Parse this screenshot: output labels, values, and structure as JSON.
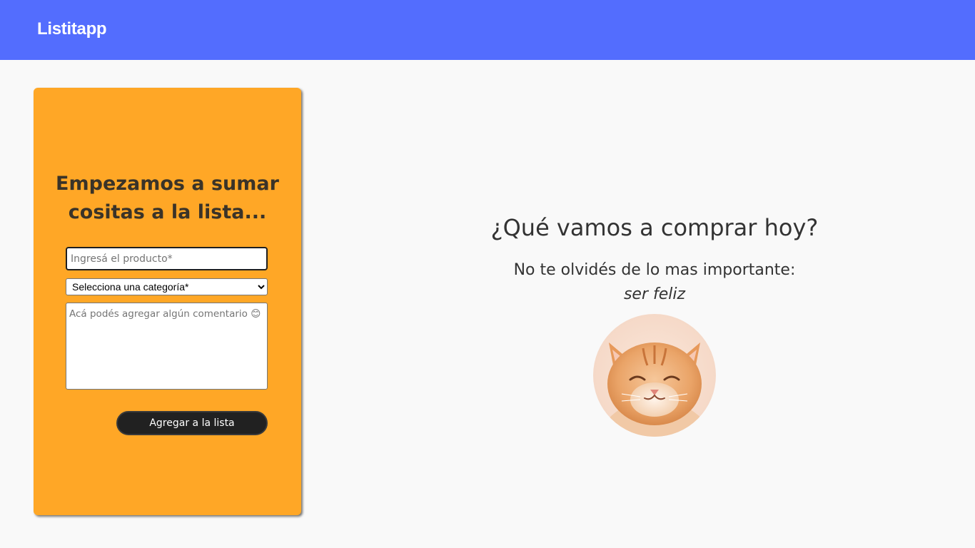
{
  "navbar": {
    "brand": "Listitapp",
    "color": "#536dfe"
  },
  "form_card": {
    "background_color": "#ffa726",
    "title": "Empezamos a sumar cositas a la lista...",
    "product_placeholder": "Ingresá el producto*",
    "category_selected": "Selecciona una categoría*",
    "comment_placeholder": "Acá podés agregar algún comentario 😊",
    "submit_label": "Agregar a la lista"
  },
  "main": {
    "heading": "¿Qué vamos a comprar hoy?",
    "reminder": "No te olvidés de lo mas importante:",
    "highlight": "ser feliz",
    "image": "smiling-cat-photo"
  }
}
